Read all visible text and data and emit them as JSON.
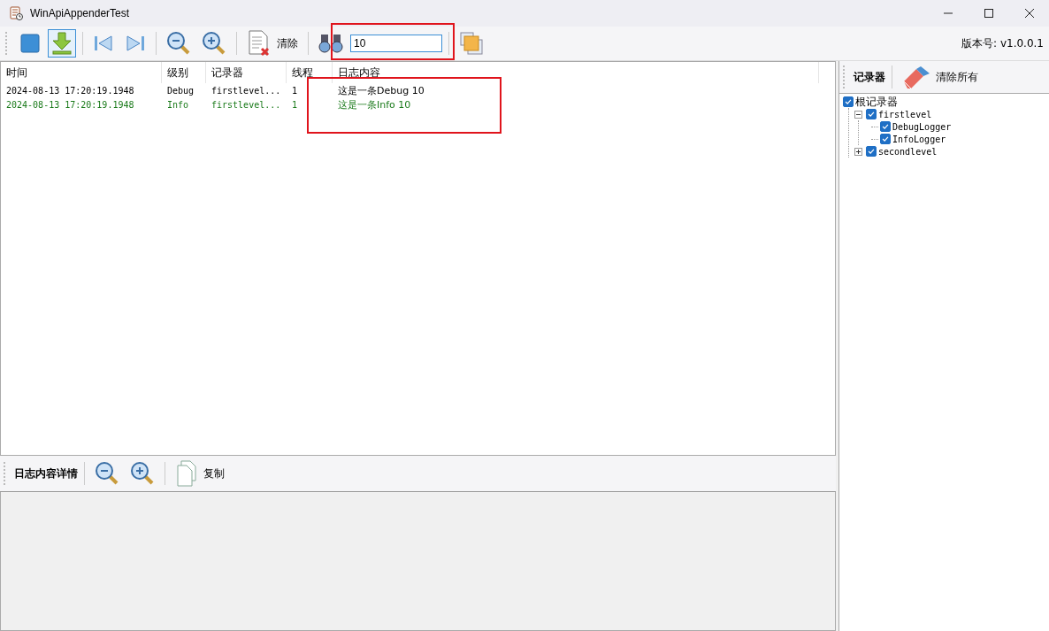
{
  "window": {
    "title": "WinApiAppenderTest"
  },
  "toolbar": {
    "items": [
      {
        "kind": "stop",
        "pressed": false
      },
      {
        "kind": "download",
        "pressed": true
      },
      {
        "kind": "sep"
      },
      {
        "kind": "first",
        "pressed": false
      },
      {
        "kind": "last",
        "pressed": false
      },
      {
        "kind": "sep"
      },
      {
        "kind": "zoomout",
        "pressed": false
      },
      {
        "kind": "zoomin",
        "pressed": false
      },
      {
        "kind": "sep"
      },
      {
        "kind": "clear",
        "pressed": false,
        "label": "清除"
      },
      {
        "kind": "sep"
      },
      {
        "kind": "find",
        "pressed": false
      },
      {
        "kind": "search",
        "value": "10",
        "highlighted": true
      },
      {
        "kind": "sep"
      },
      {
        "kind": "windows",
        "pressed": false
      }
    ],
    "version": "版本号: v1.0.0.1"
  },
  "log": {
    "columns": [
      "时间",
      "级别",
      "记录器",
      "线程",
      "日志内容"
    ],
    "content_highlighted": true,
    "rows": [
      {
        "time": "2024-08-13 17:20:19.1948",
        "level": "Debug",
        "logger": "firstlevel...",
        "thread": "1",
        "message": "这是一条Debug 10",
        "color": "#000000"
      },
      {
        "time": "2024-08-13 17:20:19.1948",
        "level": "Info",
        "logger": "firstlevel...",
        "thread": "1",
        "message": "这是一条Info 10",
        "color": "#1a7a1a"
      }
    ]
  },
  "detail": {
    "title": "日志内容详情",
    "copy_label": "复制"
  },
  "loggers": {
    "title": "记录器",
    "clear_all_label": "清除所有",
    "tree": [
      {
        "label": "根记录器",
        "checked": true,
        "children": [
          {
            "label": "firstlevel",
            "checked": true,
            "expanded": true,
            "children": [
              {
                "label": "DebugLogger",
                "checked": true
              },
              {
                "label": "InfoLogger",
                "checked": true
              }
            ]
          },
          {
            "label": "secondlevel",
            "checked": true,
            "expanded": false
          }
        ]
      }
    ]
  }
}
